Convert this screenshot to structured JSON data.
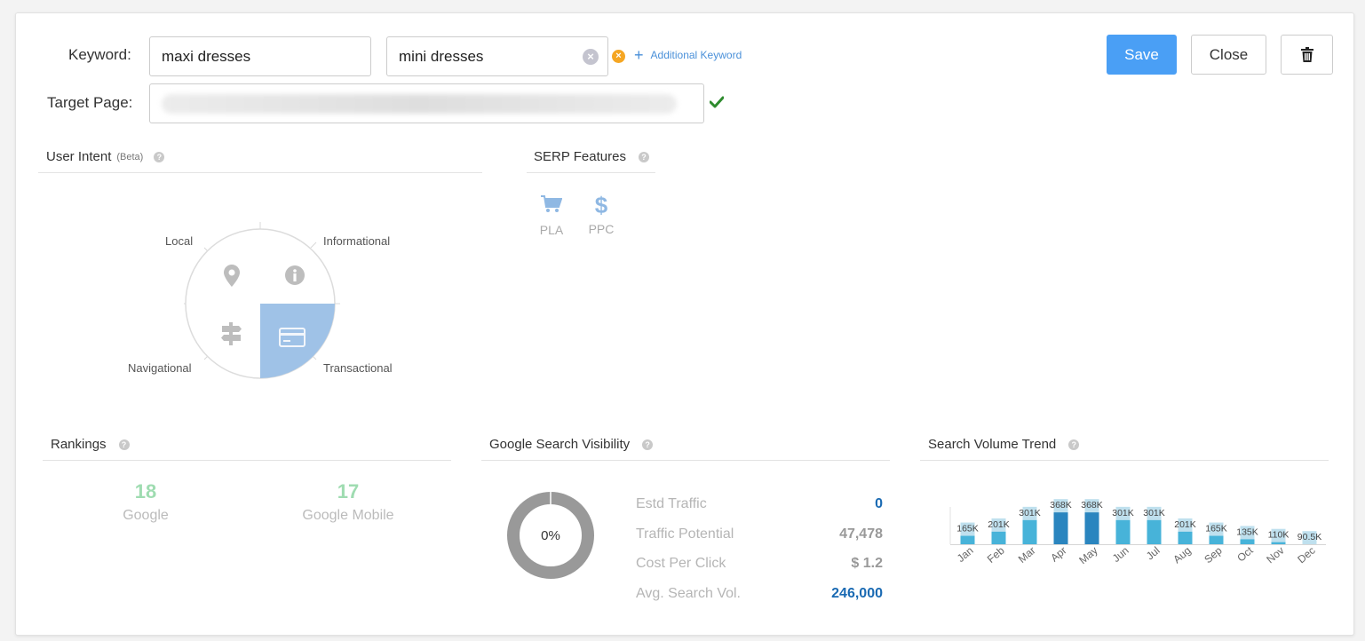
{
  "form": {
    "keyword_label": "Keyword:",
    "keyword1": "maxi dresses",
    "keyword2": "mini dresses",
    "additional_keyword": "Additional Keyword",
    "target_label": "Target Page:"
  },
  "actions": {
    "save": "Save",
    "close": "Close"
  },
  "user_intent": {
    "title": "User Intent",
    "badge": "(Beta)",
    "quadrants": {
      "local": "Local",
      "informational": "Informational",
      "navigational": "Navigational",
      "transactional": "Transactional"
    },
    "active": "transactional",
    "active_color": "#9fc2e7"
  },
  "serp_features": {
    "title": "SERP Features",
    "items": [
      {
        "label": "PLA",
        "icon": "cart-icon"
      },
      {
        "label": "PPC",
        "icon": "dollar-icon"
      }
    ]
  },
  "rankings": {
    "title": "Rankings",
    "google": {
      "value": "18",
      "label": "Google"
    },
    "mobile": {
      "value": "17",
      "label": "Google Mobile"
    }
  },
  "visibility": {
    "title": "Google Search Visibility",
    "percent_label": "0%",
    "percent": 0,
    "stats": [
      {
        "label": "Estd Traffic",
        "value": "0",
        "color": "#1a6ab3"
      },
      {
        "label": "Traffic Potential",
        "value": "47,478",
        "color": "#999999"
      },
      {
        "label": "Cost Per Click",
        "value": "$ 1.2",
        "color": "#999999"
      },
      {
        "label": "Avg. Search Vol.",
        "value": "246,000",
        "color": "#1a6ab3"
      }
    ]
  },
  "search_volume": {
    "title": "Search Volume Trend"
  },
  "chart_data": {
    "type": "bar",
    "categories": [
      "Jan",
      "Feb",
      "Mar",
      "Apr",
      "May",
      "Jun",
      "Jul",
      "Aug",
      "Sep",
      "Oct",
      "Nov",
      "Dec"
    ],
    "values": [
      165000,
      201000,
      301000,
      368000,
      368000,
      301000,
      301000,
      201000,
      165000,
      135000,
      110000,
      90500
    ],
    "value_labels": [
      "165K",
      "201K",
      "301K",
      "368K",
      "368K",
      "301K",
      "301K",
      "201K",
      "165K",
      "135K",
      "110K",
      "90.5K"
    ],
    "background_values": [
      165000,
      201000,
      301000,
      368000,
      368000,
      301000,
      301000,
      201000,
      165000,
      135000,
      110000,
      90500
    ],
    "highlight": [
      "Apr",
      "May"
    ],
    "bar_color": "#47b3d9",
    "highlight_color": "#2a85bf",
    "background_color": "#bfe0ee",
    "ylim": [
      0,
      400000
    ]
  }
}
